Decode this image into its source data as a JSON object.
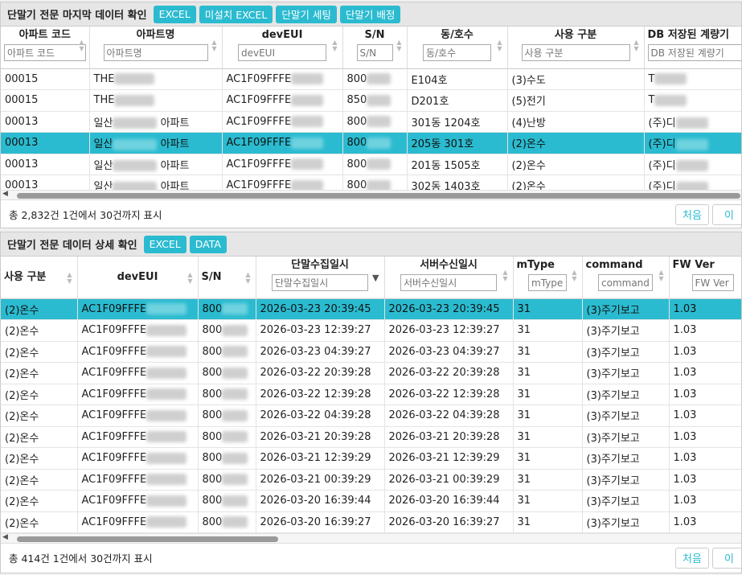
{
  "panel1": {
    "title": "단말기 전문 마지막 데이터 확인",
    "buttons": [
      "EXCEL",
      "미설치 EXCEL",
      "단말기 세팅",
      "단말기 배정"
    ],
    "columns": [
      {
        "label": "아파트 코드",
        "placeholder": "아파트 코드"
      },
      {
        "label": "아파트명",
        "placeholder": "아파트명"
      },
      {
        "label": "devEUI",
        "placeholder": "devEUI"
      },
      {
        "label": "S/N",
        "placeholder": "S/N"
      },
      {
        "label": "동/호수",
        "placeholder": "동/호수"
      },
      {
        "label": "사용 구분",
        "placeholder": "사용 구분"
      },
      {
        "label": "DB 저장된 계량기",
        "placeholder": "DB 저장된 계량기"
      }
    ],
    "rows": [
      [
        "00015",
        "THE",
        "",
        "AC1F09FFFE",
        "800",
        "E104호",
        "(3)수도",
        "T"
      ],
      [
        "00015",
        "THE",
        "",
        "AC1F09FFFE",
        "850",
        "D201호",
        "(5)전기",
        "T"
      ],
      [
        "00013",
        "일산",
        "아파트",
        "AC1F09FFFE",
        "800",
        "301동 1204호",
        "(4)난방",
        "(주)디"
      ],
      [
        "00013",
        "일산",
        "아파트",
        "AC1F09FFFE",
        "800",
        "205동 301호",
        "(2)온수",
        "(주)디"
      ],
      [
        "00013",
        "일산",
        "아파트",
        "AC1F09FFFE",
        "800",
        "201동 1505호",
        "(2)온수",
        "(주)디"
      ],
      [
        "00013",
        "일산",
        "아파트",
        "AC1F09FFFE",
        "800",
        "302동 1403호",
        "(2)온수",
        "(주)디"
      ]
    ],
    "selected_row": 3,
    "footer": "총 2,832건 1건에서 30건까지 표시",
    "pager": [
      "처음",
      "이"
    ]
  },
  "panel2": {
    "title": "단말기 전문 데이터 상세 확인",
    "buttons": [
      "EXCEL",
      "DATA"
    ],
    "columns": [
      {
        "label": "사용 구분",
        "placeholder": ""
      },
      {
        "label": "devEUI",
        "placeholder": ""
      },
      {
        "label": "S/N",
        "placeholder": ""
      },
      {
        "label": "단말수집일시",
        "placeholder": "단말수집일시"
      },
      {
        "label": "서버수신일시",
        "placeholder": "서버수신일시"
      },
      {
        "label": "mType",
        "placeholder": "mType"
      },
      {
        "label": "command",
        "placeholder": "command"
      },
      {
        "label": "FW Ver",
        "placeholder": "FW Ver"
      }
    ],
    "rows": [
      [
        "(2)온수",
        "AC1F09FFFE",
        "800",
        "2026-03-23 20:39:45",
        "2026-03-23 20:39:45",
        "31",
        "(3)주기보고",
        "1.03"
      ],
      [
        "(2)온수",
        "AC1F09FFFE",
        "800",
        "2026-03-23 12:39:27",
        "2026-03-23 12:39:27",
        "31",
        "(3)주기보고",
        "1.03"
      ],
      [
        "(2)온수",
        "AC1F09FFFE",
        "800",
        "2026-03-23 04:39:27",
        "2026-03-23 04:39:27",
        "31",
        "(3)주기보고",
        "1.03"
      ],
      [
        "(2)온수",
        "AC1F09FFFE",
        "800",
        "2026-03-22 20:39:28",
        "2026-03-22 20:39:28",
        "31",
        "(3)주기보고",
        "1.03"
      ],
      [
        "(2)온수",
        "AC1F09FFFE",
        "800",
        "2026-03-22 12:39:28",
        "2026-03-22 12:39:28",
        "31",
        "(3)주기보고",
        "1.03"
      ],
      [
        "(2)온수",
        "AC1F09FFFE",
        "800",
        "2026-03-22 04:39:28",
        "2026-03-22 04:39:28",
        "31",
        "(3)주기보고",
        "1.03"
      ],
      [
        "(2)온수",
        "AC1F09FFFE",
        "800",
        "2026-03-21 20:39:28",
        "2026-03-21 20:39:28",
        "31",
        "(3)주기보고",
        "1.03"
      ],
      [
        "(2)온수",
        "AC1F09FFFE",
        "800",
        "2026-03-21 12:39:29",
        "2026-03-21 12:39:29",
        "31",
        "(3)주기보고",
        "1.03"
      ],
      [
        "(2)온수",
        "AC1F09FFFE",
        "800",
        "2026-03-21 00:39:29",
        "2026-03-21 00:39:29",
        "31",
        "(3)주기보고",
        "1.03"
      ],
      [
        "(2)온수",
        "AC1F09FFFE",
        "800",
        "2026-03-20 16:39:44",
        "2026-03-20 16:39:44",
        "31",
        "(3)주기보고",
        "1.03"
      ],
      [
        "(2)온수",
        "AC1F09FFFE",
        "800",
        "2026-03-20 16:39:27",
        "2026-03-20 16:39:27",
        "31",
        "(3)주기보고",
        "1.03"
      ]
    ],
    "selected_row": 0,
    "footer": "총 414건 1건에서 30건까지 표시",
    "pager": [
      "처음",
      "이"
    ]
  },
  "colors": {
    "accent": "#2bbbd0"
  },
  "icons": {
    "sort": "sort-arrows-icon",
    "sort_desc": "sort-desc-icon",
    "scroll_left": "scroll-left-arrow-icon"
  }
}
